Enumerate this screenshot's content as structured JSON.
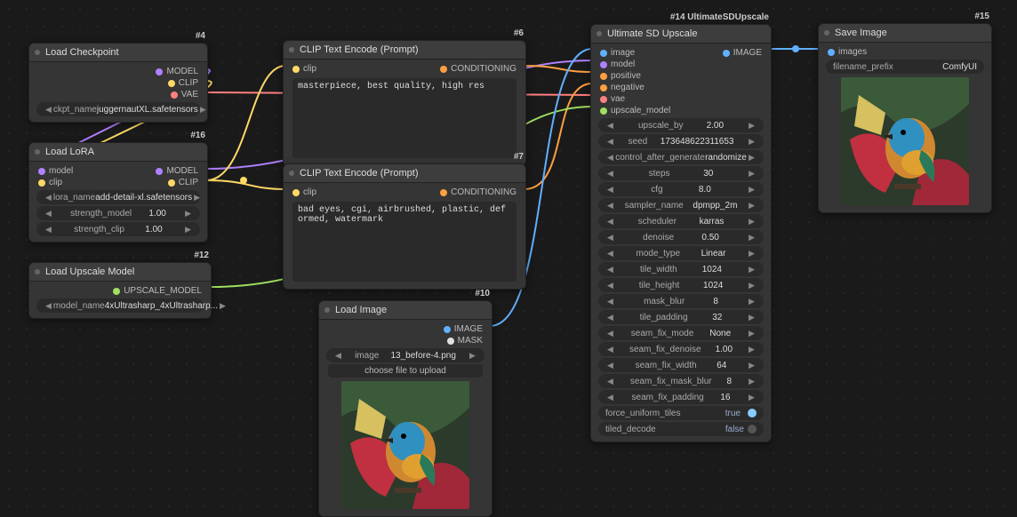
{
  "nodes": {
    "load_checkpoint": {
      "id": "#4",
      "title": "Load Checkpoint",
      "outputs": [
        "MODEL",
        "CLIP",
        "VAE"
      ],
      "ckpt_name_label": "ckpt_name",
      "ckpt_name_value": "juggernautXL.safetensors"
    },
    "load_lora": {
      "id": "#16",
      "title": "Load LoRA",
      "inputs": [
        "model",
        "clip"
      ],
      "outputs": [
        "MODEL",
        "CLIP"
      ],
      "widgets": [
        {
          "label": "lora_name",
          "value": "add-detail-xl.safetensors"
        },
        {
          "label": "strength_model",
          "value": "1.00"
        },
        {
          "label": "strength_clip",
          "value": "1.00"
        }
      ]
    },
    "load_upscale": {
      "id": "#12",
      "title": "Load Upscale Model",
      "outputs": [
        "UPSCALE_MODEL"
      ],
      "model_name_label": "model_name",
      "model_name_value": "4xUltrasharp_4xUltrasharp..."
    },
    "clip_pos": {
      "id": "#6",
      "title": "CLIP Text Encode (Prompt)",
      "inputs": [
        "clip"
      ],
      "outputs": [
        "CONDITIONING"
      ],
      "text": "masterpiece, best quality, high res"
    },
    "clip_neg": {
      "id": "#7",
      "title": "CLIP Text Encode (Prompt)",
      "inputs": [
        "clip"
      ],
      "outputs": [
        "CONDITIONING"
      ],
      "text": "bad eyes, cgi, airbrushed, plastic, deformed, watermark"
    },
    "load_image": {
      "id": "#10",
      "title": "Load Image",
      "outputs": [
        "IMAGE",
        "MASK"
      ],
      "image_label": "image",
      "image_value": "13_before-4.png",
      "upload_button": "choose file to upload"
    },
    "ultimate": {
      "id": "#14 UltimateSDUpscale",
      "title": "Ultimate SD Upscale",
      "inputs": [
        "image",
        "model",
        "positive",
        "negative",
        "vae",
        "upscale_model"
      ],
      "outputs": [
        "IMAGE"
      ],
      "widgets": [
        {
          "label": "upscale_by",
          "value": "2.00"
        },
        {
          "label": "seed",
          "value": "173648622311653"
        },
        {
          "label": "control_after_generate",
          "value": "randomize"
        },
        {
          "label": "steps",
          "value": "30"
        },
        {
          "label": "cfg",
          "value": "8.0"
        },
        {
          "label": "sampler_name",
          "value": "dpmpp_2m"
        },
        {
          "label": "scheduler",
          "value": "karras"
        },
        {
          "label": "denoise",
          "value": "0.50"
        },
        {
          "label": "mode_type",
          "value": "Linear"
        },
        {
          "label": "tile_width",
          "value": "1024"
        },
        {
          "label": "tile_height",
          "value": "1024"
        },
        {
          "label": "mask_blur",
          "value": "8"
        },
        {
          "label": "tile_padding",
          "value": "32"
        },
        {
          "label": "seam_fix_mode",
          "value": "None"
        },
        {
          "label": "seam_fix_denoise",
          "value": "1.00"
        },
        {
          "label": "seam_fix_width",
          "value": "64"
        },
        {
          "label": "seam_fix_mask_blur",
          "value": "8"
        },
        {
          "label": "seam_fix_padding",
          "value": "16"
        }
      ],
      "toggles": [
        {
          "label": "force_uniform_tiles",
          "value": "true",
          "on": true
        },
        {
          "label": "tiled_decode",
          "value": "false",
          "on": false
        }
      ]
    },
    "save_image": {
      "id": "#15",
      "title": "Save Image",
      "inputs": [
        "images"
      ],
      "filename_label": "filename_prefix",
      "filename_value": "ComfyUI"
    }
  }
}
